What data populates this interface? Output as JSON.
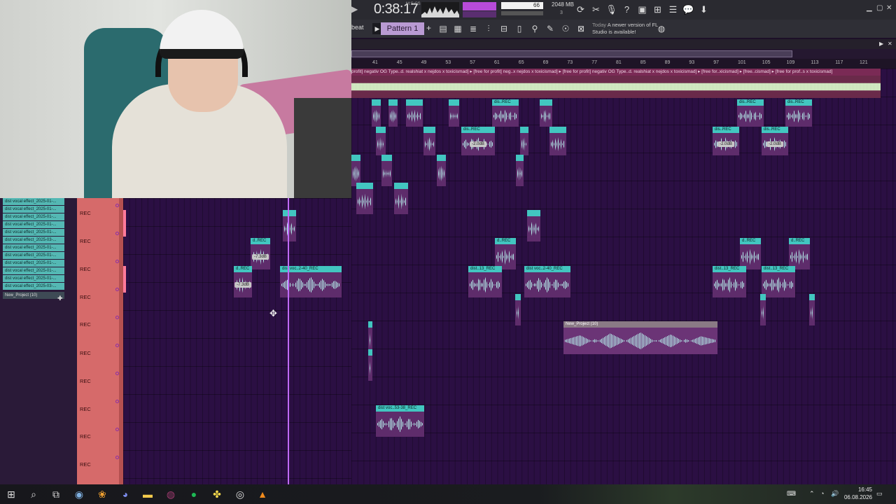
{
  "toolbar": {
    "time": "0:38:17",
    "time_unit": "M:S:CS",
    "volume": "66",
    "memory": "2048 MB",
    "cpu_cores": "3",
    "pattern_label": "Pattern 1",
    "beat_label": "beat",
    "news_day": "Today",
    "news_text": "A newer version of FL Studio is available!"
  },
  "ruler": {
    "bars": [
      "41",
      "45",
      "49",
      "53",
      "57",
      "61",
      "65",
      "69",
      "73",
      "77",
      "81",
      "85",
      "89",
      "93",
      "97",
      "101",
      "105",
      "109",
      "113",
      "117",
      "121"
    ]
  },
  "beat_track": {
    "header": "profit] negativ OG Type..d. realshiat x nejdos x toxicismad]  ▸ [free for profit] neg..x nejdos x toxicismad]  ▸ [free for profit] negativ OG Type..d. realshiat x nejdos x toxicismad]  ▸ [free for..xicismad]  ▸  [free..cismad]  ▸ [free for prof..s x toxicismad]"
  },
  "left_panel": {
    "items": [
      "dist vocal effect_2025-01-...",
      "dist vocal effect_2025-01-...",
      "dist vocal effect_2025-01-...",
      "dist vocal effect_2025-01-...",
      "dist vocal effect_2025-01-...",
      "dist vocal effect_2025-03-...",
      "dist vocal effect_2025-01-...",
      "dist vocal effect_2025-01-...",
      "dist vocal effect_2025-01-...",
      "dist vocal effect_2025-01-...",
      "dist vocal effect_2025-01-...",
      "dist vocal effect_2025-03-..."
    ],
    "project_item": "New_Project (10)"
  },
  "tracks": {
    "rec_label": "REC"
  },
  "clips": {
    "d_rec": "d..REC",
    "dis_rec": "dis..REC",
    "dist13_rec": "dist..13_REC",
    "distvoc_240": "dist voc..2-40_REC",
    "distvoc_5338": "dist voc..53-38_REC",
    "new_project": "New_Project (10)",
    "gain_20": "-2.0dB",
    "gain_73": "-7.3dB"
  },
  "taskbar": {
    "time": "16:45",
    "date": "06.08.2026"
  }
}
